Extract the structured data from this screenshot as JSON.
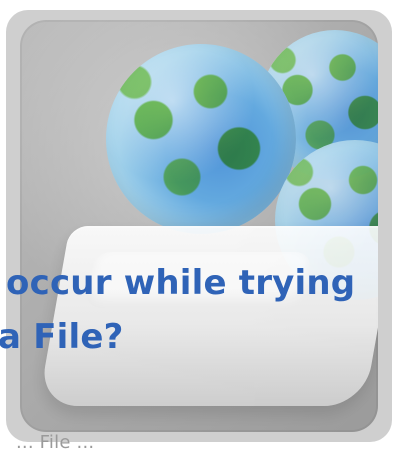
{
  "thumbnail": {
    "headline_line_1": "hat occur while trying",
    "headline_line_2": "Data File?"
  },
  "below_text": "... File  ...",
  "colors": {
    "headline": "#2f63b7",
    "background": "#ffffff",
    "card": "#cfcfcf"
  }
}
